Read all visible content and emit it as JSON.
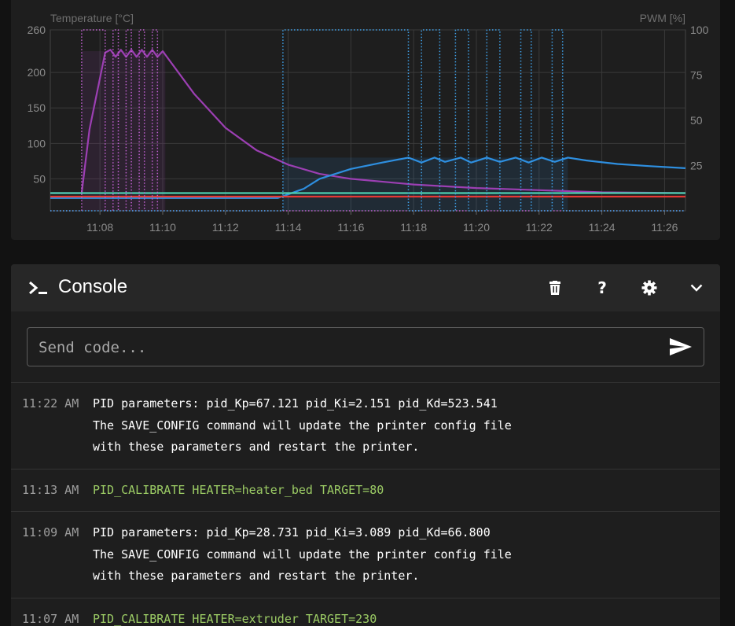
{
  "chart": {
    "left_axis_title": "Temperature [°C]",
    "right_axis_title": "PWM [%]",
    "y_left_ticks": [
      "260",
      "200",
      "150",
      "100",
      "50"
    ],
    "y_right_ticks": [
      "100",
      "75",
      "50",
      "25"
    ],
    "x_ticks": [
      "11:08",
      "11:10",
      "11:12",
      "11:14",
      "11:16",
      "11:18",
      "11:20",
      "11:22",
      "11:24",
      "11:26"
    ]
  },
  "chart_data": {
    "type": "line",
    "title": "",
    "xlabel": "",
    "ylabel": "Temperature [°C]",
    "y2label": "PWM [%]",
    "ylim": [
      5,
      260
    ],
    "y2lim": [
      0,
      100
    ],
    "xlim": [
      "11:06:25",
      "11:26:40"
    ],
    "grid": true,
    "legend": "none",
    "series": [
      {
        "axis": "left",
        "color": "#9c3fb3",
        "x": [
          "11:06:25",
          "11:07:25",
          "11:07:40",
          "11:08:10",
          "11:08:20",
          "11:08:30",
          "11:08:40",
          "11:08:50",
          "11:09:00",
          "11:09:10",
          "11:09:20",
          "11:09:30",
          "11:09:40",
          "11:09:50",
          "11:10:00",
          "11:11:00",
          "11:12:00",
          "11:13:00",
          "11:14:00",
          "11:15:00",
          "11:16:00",
          "11:18:00",
          "11:20:00",
          "11:22:00",
          "11:24:00",
          "11:26:40"
        ],
        "values": [
          30,
          30,
          120,
          228,
          232,
          222,
          232,
          222,
          232,
          222,
          232,
          222,
          232,
          222,
          230,
          170,
          122,
          90,
          70,
          57,
          50,
          42,
          37,
          34,
          31,
          30
        ]
      },
      {
        "axis": "left",
        "color": "#2e8fe0",
        "x": [
          "11:06:25",
          "11:13:40",
          "11:14:30",
          "11:15:00",
          "11:16:00",
          "11:17:00",
          "11:17:50",
          "11:18:15",
          "11:18:40",
          "11:19:00",
          "11:19:30",
          "11:19:50",
          "11:20:20",
          "11:20:45",
          "11:21:15",
          "11:21:40",
          "11:22:05",
          "11:22:30",
          "11:22:55",
          "11:23:30",
          "11:24:30",
          "11:25:30",
          "11:26:40"
        ],
        "values": [
          23,
          23,
          36,
          50,
          64,
          73,
          80,
          73,
          80,
          74,
          80,
          73,
          80,
          74,
          80,
          73,
          80,
          74,
          80,
          76,
          71,
          68,
          65
        ]
      },
      {
        "axis": "left",
        "color": "#4dd0b0",
        "x": [
          "11:06:25",
          "11:26:40"
        ],
        "values": [
          30,
          30
        ]
      },
      {
        "axis": "left",
        "color": "#e53935",
        "x": [
          "11:06:25",
          "11:26:40"
        ],
        "values": [
          25,
          25
        ]
      },
      {
        "axis": "right",
        "color": "#c060d0",
        "style": "dotted",
        "x": [
          "11:06:25",
          "11:07:25",
          "11:07:25",
          "11:08:10",
          "11:08:10",
          "11:08:25",
          "11:08:25",
          "11:08:35",
          "11:08:35",
          "11:08:50",
          "11:08:50",
          "11:09:00",
          "11:09:00",
          "11:09:15",
          "11:09:15",
          "11:09:25",
          "11:09:25",
          "11:09:40",
          "11:09:40",
          "11:09:50",
          "11:09:50",
          "11:26:40"
        ],
        "values": [
          0,
          0,
          100,
          100,
          0,
          0,
          100,
          100,
          0,
          0,
          100,
          100,
          0,
          0,
          100,
          100,
          0,
          0,
          100,
          100,
          0,
          0
        ]
      },
      {
        "axis": "right",
        "color": "#3fa0e8",
        "style": "dotted",
        "x": [
          "11:06:25",
          "11:13:50",
          "11:13:50",
          "11:17:50",
          "11:17:50",
          "11:18:15",
          "11:18:15",
          "11:18:50",
          "11:18:50",
          "11:19:20",
          "11:19:20",
          "11:19:45",
          "11:19:45",
          "11:20:20",
          "11:20:20",
          "11:20:45",
          "11:20:45",
          "11:21:25",
          "11:21:25",
          "11:21:45",
          "11:21:45",
          "11:22:25",
          "11:22:25",
          "11:22:45",
          "11:22:45",
          "11:26:40"
        ],
        "values": [
          0,
          0,
          100,
          100,
          0,
          0,
          100,
          100,
          0,
          0,
          100,
          100,
          0,
          0,
          100,
          100,
          0,
          0,
          100,
          100,
          0,
          0,
          100,
          100,
          0,
          0
        ]
      }
    ]
  },
  "console": {
    "title": "Console",
    "input_placeholder": "Send code...",
    "entries": [
      {
        "time": "11:22 AM",
        "message": "PID parameters: pid_Kp=67.121 pid_Ki=2.151 pid_Kd=523.541\nThe SAVE_CONFIG command will update the printer config file\nwith these parameters and restart the printer."
      },
      {
        "time": "11:13 AM",
        "message": "PID_CALIBRATE HEATER=heater_bed TARGET=80"
      },
      {
        "time": "11:09 AM",
        "message": "PID parameters: pid_Kp=28.731 pid_Ki=3.089 pid_Kd=66.800\nThe SAVE_CONFIG command will update the printer config file\nwith these parameters and restart the printer."
      },
      {
        "time": "11:07 AM",
        "message": "PID_CALIBRATE HEATER=extruder TARGET=230"
      }
    ]
  },
  "icons": {
    "console": "console-prompt-icon",
    "clear": "trash-icon",
    "help": "help-icon",
    "settings": "gear-icon",
    "collapse": "chevron-down-icon",
    "send": "send-icon"
  },
  "colors": {
    "command_text": "#9ccc65",
    "extruder": "#9c3fb3",
    "heater_bed": "#2e8fe0"
  }
}
